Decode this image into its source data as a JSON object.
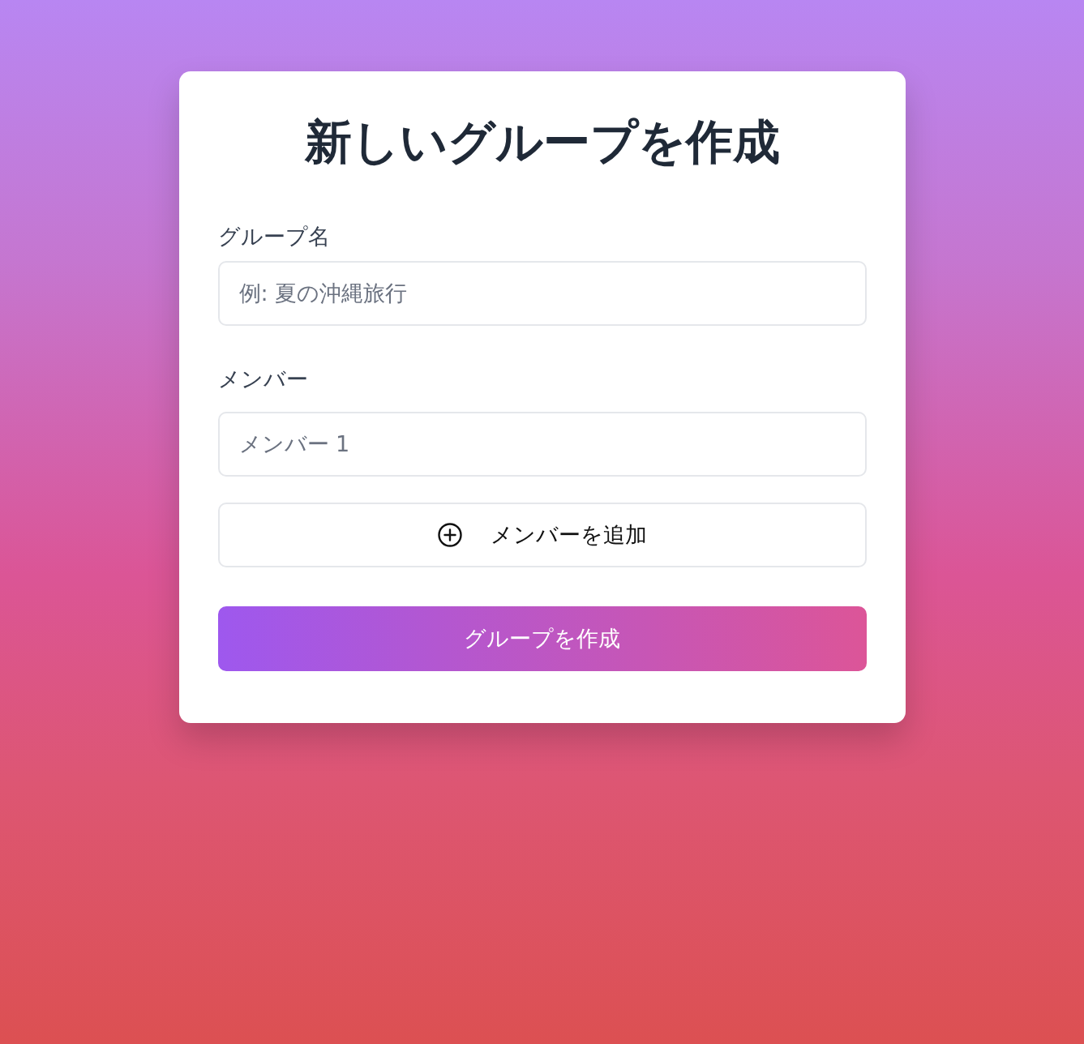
{
  "title": "新しいグループを作成",
  "group_name": {
    "label": "グループ名",
    "placeholder": "例: 夏の沖縄旅行"
  },
  "members": {
    "label": "メンバー",
    "fields": [
      {
        "placeholder": "メンバー 1"
      }
    ],
    "add_button": "メンバーを追加"
  },
  "submit_button": "グループを作成"
}
